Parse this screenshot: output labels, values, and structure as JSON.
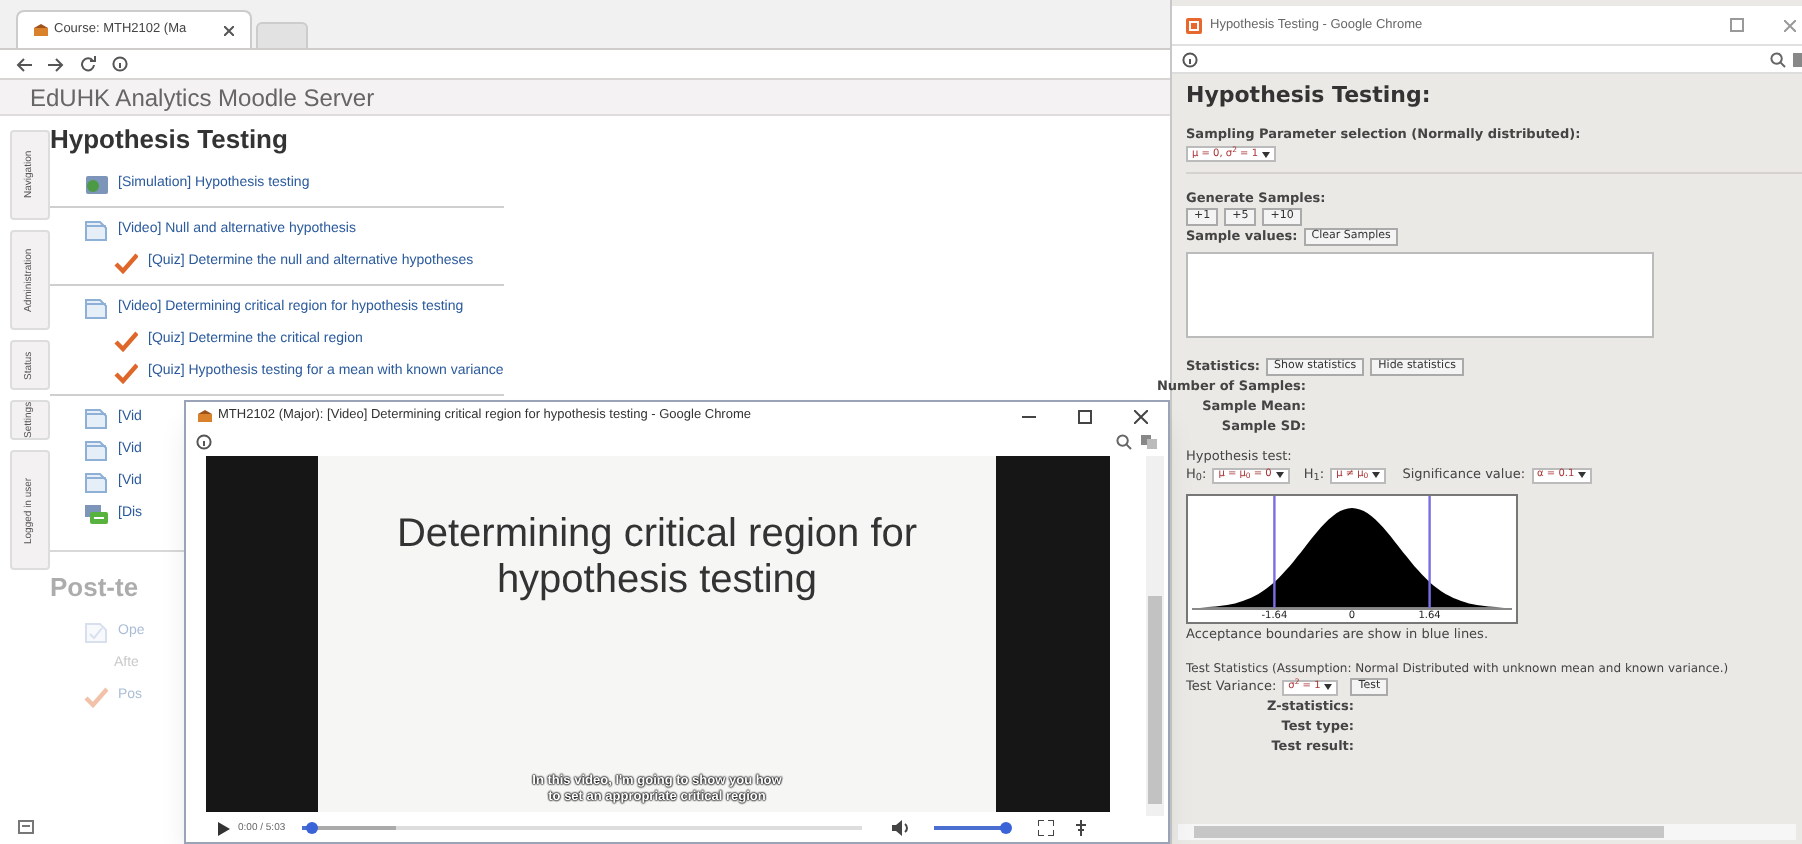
{
  "browser": {
    "tab": "Course: MTH2102 (Ma",
    "site_title": "EdUHK Analytics Moodle Server",
    "side_tabs": [
      "Navigation",
      "Administration",
      "Status",
      "Settings",
      "Logged in user"
    ],
    "sections": [
      {
        "title": "Hypothesis Testing",
        "dimmed": false,
        "groups": [
          [
            {
              "kind": "simulation",
              "text": "[Simulation] Hypothesis testing"
            }
          ],
          [
            {
              "kind": "video",
              "text": "[Video] Null and alternative hypothesis",
              "children": [
                {
                  "kind": "quiz",
                  "text": "[Quiz] Determine the null and alternative hypotheses"
                }
              ]
            }
          ],
          [
            {
              "kind": "video",
              "text": "[Video] Determining critical region for hypothesis testing",
              "children": [
                {
                  "kind": "quiz",
                  "text": "[Quiz] Determine the critical region"
                },
                {
                  "kind": "quiz",
                  "text": "[Quiz] Hypothesis testing for a mean with known variance"
                }
              ]
            }
          ],
          [
            {
              "kind": "video",
              "text": "[Vid"
            },
            {
              "kind": "video",
              "text": "[Vid"
            },
            {
              "kind": "video",
              "text": "[Vid"
            },
            {
              "kind": "forum",
              "text": "[Dis"
            }
          ]
        ]
      },
      {
        "title": "Post-te",
        "dimmed": true,
        "groups": [
          [
            {
              "kind": "assignment",
              "text": "Ope",
              "children": [
                {
                  "kind": "note",
                  "text": "Afte"
                }
              ]
            },
            {
              "kind": "quiz",
              "text": "Pos"
            }
          ]
        ]
      }
    ]
  },
  "video_window": {
    "title": "MTH2102 (Major): [Video] Determining critical region for hypothesis testing - Google Chrome",
    "slide_title_lines": [
      "Determining critical region for",
      "hypothesis testing"
    ],
    "subtitle_lines": [
      "In this video, I'm going to show you how",
      "to set an appropriate critical region"
    ],
    "time": "0:00 / 5:03",
    "progress": {
      "level": 0.02
    },
    "volume": {
      "level": 0.95
    }
  },
  "app_window": {
    "title": "Hypothesis Testing - Google Chrome",
    "heading": "Hypothesis Testing:",
    "sampling_label": "Sampling Parameter selection (Normally distributed):",
    "sampling_select": "μ = 0, σ$^{2}$ = 1",
    "generate_label": "Generate Samples:",
    "generate_buttons": [
      "+1",
      "+5",
      "+10"
    ],
    "sample_values_label": "Sample values:",
    "clear_button": "Clear Samples",
    "statistics_label": "Statistics:",
    "statistics_buttons": [
      "Show statistics",
      "Hide statistics"
    ],
    "statistics_fields": [
      "Number of Samples:",
      "Sample Mean:",
      "Sample SD:"
    ],
    "hypothesis_label": "Hypothesis test:",
    "h0_label": "H$_{0}$:",
    "h0_select": "μ = μ$_{0}$ = 0",
    "h1_label": "H$_{1}$:",
    "h1_select": "μ ≠ μ$_{0}$",
    "significance_label": "Significance value:",
    "significance_select": "α = 0.1",
    "plot": {
      "tick_labels": [
        "-1.64",
        "0",
        "1.64"
      ]
    },
    "caption": "Acceptance boundaries are show in blue lines.",
    "test_label": "Test Statistics (Assumption: Normal Distributed with unknown mean and known variance.)",
    "variance_label": "Test Variance:",
    "variance_select": "σ$^{2}$ = 1",
    "test_button": "Test",
    "result_fields": [
      "Z-statistics:",
      "Test type:",
      "Test result:"
    ]
  }
}
